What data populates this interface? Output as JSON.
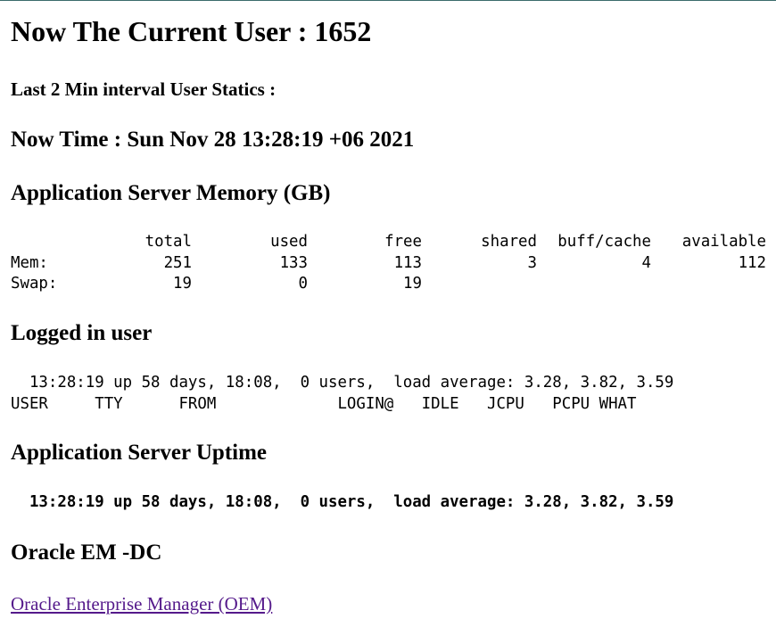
{
  "current_user": {
    "heading": "Now The Current User : 1652"
  },
  "interval": {
    "heading": "Last 2 Min interval User Statics :"
  },
  "now_time": {
    "heading": "Now Time : Sun Nov 28 13:28:19 +06 2021"
  },
  "memory": {
    "heading": "Application Server Memory (GB)",
    "columns": [
      "total",
      "used",
      "free",
      "shared",
      "buff/cache",
      "available"
    ],
    "rows": [
      {
        "label": "Mem:",
        "values": [
          "251",
          "133",
          "113",
          "3",
          "4",
          "112"
        ]
      },
      {
        "label": "Swap:",
        "values": [
          "19",
          "0",
          "19",
          "",
          "",
          ""
        ]
      }
    ]
  },
  "logged_in": {
    "heading": "Logged in user",
    "status_line": "  13:28:19 up 58 days, 18:08,  0 users,  load average: 3.28, 3.82, 3.59",
    "header_line": "USER     TTY      FROM             LOGIN@   IDLE   JCPU   PCPU WHAT"
  },
  "uptime": {
    "heading": "Application Server Uptime",
    "status_line": "  13:28:19 up 58 days, 18:08,  0 users,  load average: 3.28, 3.82, 3.59"
  },
  "oracle": {
    "heading": "Oracle EM -DC",
    "link_label": "Oracle Enterprise Manager (OEM)"
  }
}
